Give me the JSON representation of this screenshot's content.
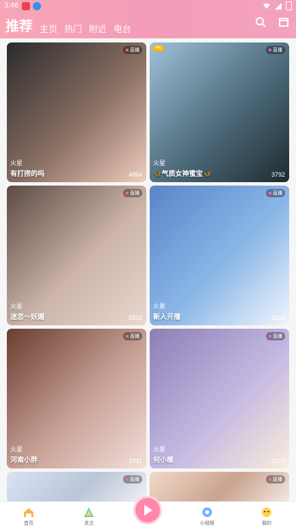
{
  "status": {
    "time": "3:46"
  },
  "tabs": [
    "推荐",
    "主页",
    "热门",
    "附近",
    "电台"
  ],
  "cards": [
    {
      "tag": "火星",
      "name": "有打捞的吗",
      "count": "4864",
      "badge": "直播",
      "pk": "",
      "colors": [
        "#2b2b2b",
        "#8a6f63",
        "#efcdbd"
      ]
    },
    {
      "tag": "火星",
      "name": "🦋气质女神蜜宝🦋",
      "count": "3792",
      "badge": "直播",
      "pk": "PK",
      "colors": [
        "#9fc1d8",
        "#4c6a7a",
        "#1f2b30"
      ]
    },
    {
      "tag": "火星",
      "name": "迷恋～妖媚",
      "count": "3322",
      "badge": "直播",
      "pk": "",
      "colors": [
        "#5b4a43",
        "#cbb3a7",
        "#e9d8cf"
      ]
    },
    {
      "tag": "火星",
      "name": "新人开播",
      "count": "2615",
      "badge": "直播",
      "pk": "",
      "colors": [
        "#5b84c8",
        "#8bb7e8",
        "#f1f4fb"
      ]
    },
    {
      "tag": "火星",
      "name": "河南小胖",
      "count": "2411",
      "badge": "直播",
      "pk": "",
      "colors": [
        "#6a3d2f",
        "#c9a197",
        "#f2e0dc"
      ]
    },
    {
      "tag": "火星",
      "name": "何小暖",
      "count": "2213",
      "badge": "直播",
      "pk": "",
      "colors": [
        "#8b7fb6",
        "#c4b8e2",
        "#f8eddb"
      ]
    },
    {
      "tag": "",
      "name": "",
      "count": "",
      "badge": "直播",
      "pk": "",
      "colors": [
        "#d9e3f3",
        "#b9c5d8",
        "#f1f1f1"
      ]
    },
    {
      "tag": "",
      "name": "",
      "count": "",
      "badge": "直播",
      "pk": "",
      "colors": [
        "#f2d8c7",
        "#c9a38f",
        "#f3e9e3"
      ]
    }
  ],
  "nav": [
    "首页",
    "关注",
    "",
    "小视频",
    "我的"
  ],
  "icons": [
    "search-icon",
    "calendar-icon",
    "home-icon",
    "follow-icon",
    "play-icon",
    "video-icon",
    "profile-icon"
  ]
}
